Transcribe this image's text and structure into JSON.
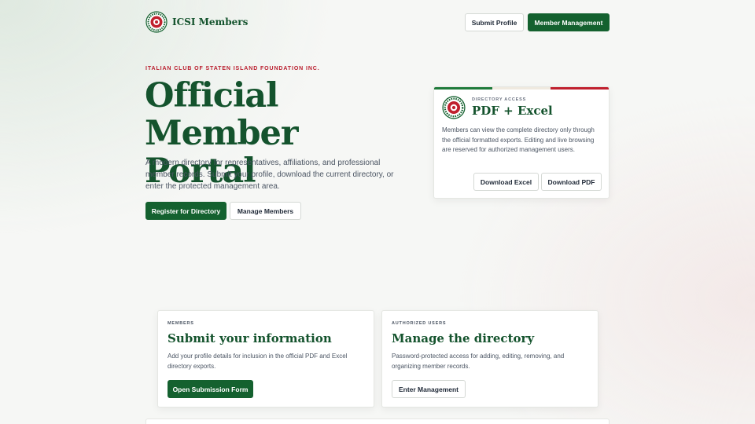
{
  "header": {
    "brand_name": "ICSI Members",
    "submit_profile_label": "Submit Profile",
    "member_management_label": "Member Management"
  },
  "hero": {
    "kicker": "ITALIAN CLUB OF STATEN ISLAND FOUNDATION INC.",
    "title_line1": "Official Member",
    "title_line2": "Portal",
    "description": "A modern directory for representatives, affiliations, and professional member records. Submit your profile, download the current directory, or enter the protected management area.",
    "register_label": "Register for Directory",
    "manage_label": "Manage Members"
  },
  "directory_card": {
    "kicker": "DIRECTORY ACCESS",
    "title": "PDF + Excel",
    "text": "Members can view the complete directory only through the official formatted exports. Editing and live browsing are reserved for authorized management users.",
    "excel_label": "Download Excel",
    "pdf_label": "Download PDF"
  },
  "features": [
    {
      "kicker": "MEMBERS",
      "title": "Submit your information",
      "text": "Add your profile details for inclusion in the official PDF and Excel directory exports.",
      "button_label": "Open Submission Form"
    },
    {
      "kicker": "AUTHORIZED USERS",
      "title": "Manage the directory",
      "text": "Password-protected access for adding, editing, removing, and organizing member records.",
      "button_label": "Enter Management"
    }
  ],
  "colors": {
    "brand_green": "#14612f",
    "title_green": "#14532d",
    "accent_red": "#b91c2c",
    "flag_green": "#1f7a3a",
    "flag_white": "#efe9df",
    "flag_red": "#c0202e"
  },
  "icons": {
    "logo": "club-seal-logo-icon"
  }
}
